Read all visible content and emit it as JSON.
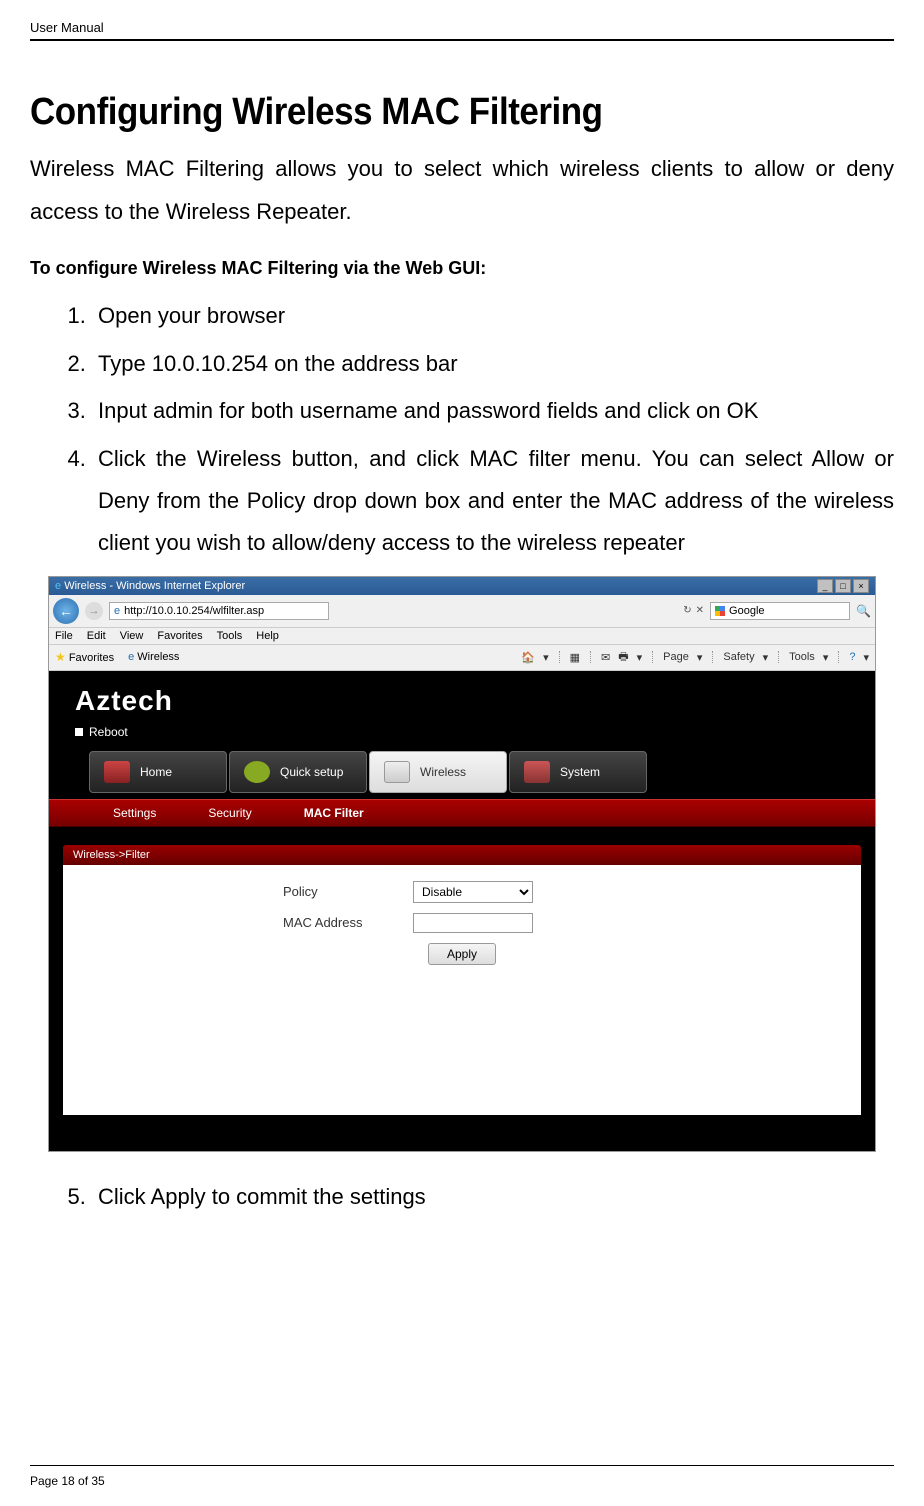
{
  "header": {
    "label": "User Manual"
  },
  "title": "Configuring Wireless MAC Filtering",
  "intro": "Wireless MAC Filtering allows you to select which wireless clients to allow or deny access to the Wireless Repeater.",
  "sub_heading": "To configure Wireless MAC Filtering via the Web GUI:",
  "steps": [
    "Open your browser",
    "Type 10.0.10.254 on the address bar",
    "Input admin for both username and password fields and click on OK",
    "Click the Wireless button, and click MAC filter menu. You can select Allow or Deny from the Policy drop down box and enter the MAC address of the wireless client you wish to allow/deny access to the wireless repeater"
  ],
  "step5": "Click Apply to commit the settings",
  "ie": {
    "title_text": "Wireless - Windows Internet Explorer",
    "address": "http://10.0.10.254/wlfilter.asp",
    "search_hint": "Google",
    "menu": {
      "file": "File",
      "edit": "Edit",
      "view": "View",
      "favorites": "Favorites",
      "tools": "Tools",
      "help": "Help"
    },
    "favbar": {
      "favorites": "Favorites",
      "tab": "Wireless"
    },
    "right_tools": {
      "page": "Page",
      "safety": "Safety",
      "tools": "Tools"
    }
  },
  "router": {
    "brand": "Aztech",
    "reboot": "Reboot",
    "nav": {
      "home": "Home",
      "quick": "Quick setup",
      "wireless": "Wireless",
      "system": "System"
    },
    "tabs": {
      "settings": "Settings",
      "security": "Security",
      "mac_filter": "MAC Filter"
    },
    "panel_title": "Wireless->Filter",
    "form": {
      "policy_label": "Policy",
      "policy_value": "Disable",
      "mac_label": "MAC Address",
      "apply": "Apply"
    }
  },
  "footer": {
    "page": "Page 18 of 35"
  }
}
